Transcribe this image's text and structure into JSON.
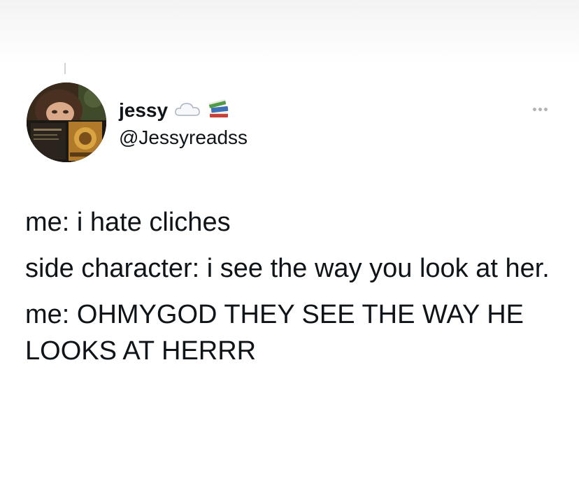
{
  "author": {
    "display_name": "jessy",
    "handle": "@Jessyreadss",
    "badges": [
      "cloud-icon",
      "books-icon"
    ],
    "avatar": "avatar-photo"
  },
  "menu": {
    "icon": "more-options-icon"
  },
  "tweet": {
    "lines": [
      "me: i hate cliches",
      "side character: i see the way you look at her.",
      "me: OHMYGOD THEY SEE THE WAY HE LOOKS AT HERRR"
    ]
  }
}
